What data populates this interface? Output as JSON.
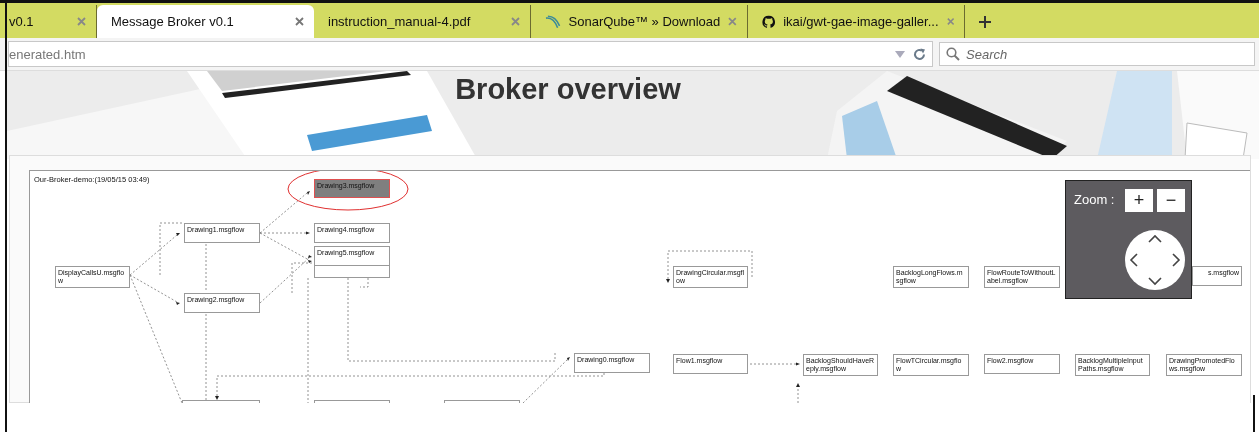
{
  "tabs": [
    {
      "title": "v0.1",
      "selected": false
    },
    {
      "title": "Message Broker v0.1",
      "selected": true
    },
    {
      "title": "instruction_manual-4.pdf",
      "selected": false
    },
    {
      "title": "SonarQube™ » Download",
      "selected": false
    },
    {
      "title": "ikai/gwt-gae-image-galler...",
      "selected": false
    }
  ],
  "address_bar": {
    "value": "enerated.htm"
  },
  "search": {
    "placeholder": "Search"
  },
  "page": {
    "heading": "Broker overview"
  },
  "diagram": {
    "title": "Our-Broker-demo:(19/05/15 03:49)",
    "nodes": [
      {
        "label": "Drawing3.msgflow",
        "highlighted": true
      },
      {
        "label": "Drawing1.msgflow",
        "highlighted": false
      },
      {
        "label": "Drawing4.msgflow",
        "highlighted": false
      },
      {
        "highlighted": false
      },
      {
        "label": "Drawing5.msgflow",
        "highlighted": false
      },
      {
        "label": "DisplayCallsU.msgflow",
        "highlighted": false
      },
      {
        "label": "Drawing2.msgflow",
        "highlighted": false
      },
      {
        "label": "DrawingCircular.msgflow",
        "highlighted": false
      },
      {
        "label": "Drawing0.msgflow",
        "highlighted": false
      },
      {
        "label": "Flow1.msgflow",
        "highlighted": false
      },
      {
        "label": "BacklogShouldHaveReply.msgflow",
        "highlighted": false
      },
      {
        "label": "BacklogLongFlows.msgflow",
        "highlighted": false
      },
      {
        "label": "FlowRouteToWithoutLabel.msgflow",
        "highlighted": false
      },
      {
        "label": "s.msgflow",
        "highlighted": false
      },
      {
        "label": "FlowTCircular.msgflow",
        "highlighted": false
      },
      {
        "label": "Flow2.msgflow",
        "highlighted": false
      },
      {
        "label": "BacklogMultipleInputPaths.msgflow",
        "highlighted": false
      },
      {
        "label": "DrawingPromotedFlows.msgflow",
        "highlighted": false
      },
      {
        "highlighted": false
      },
      {
        "highlighted": false
      },
      {
        "highlighted": false
      }
    ],
    "zoom": {
      "label": "Zoom :",
      "plus": "+",
      "minus": "−"
    }
  }
}
